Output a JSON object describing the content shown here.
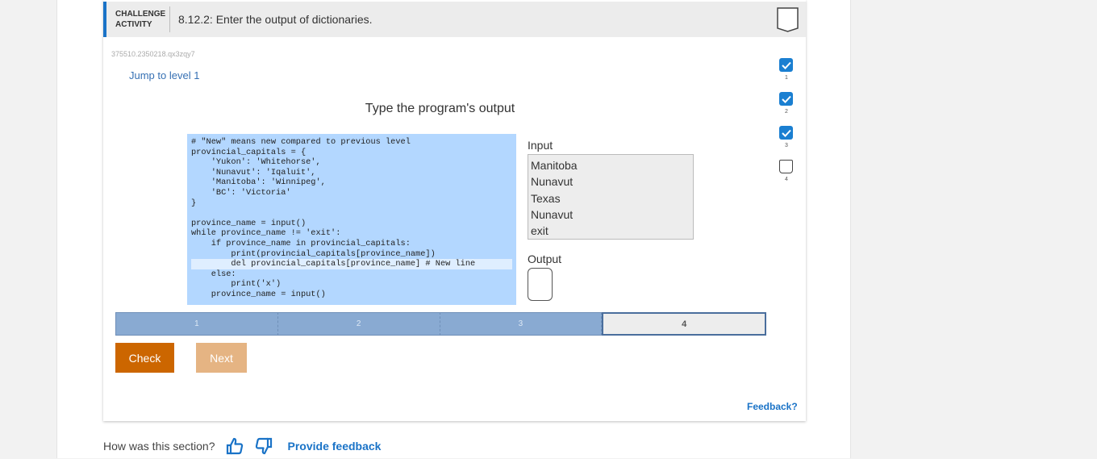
{
  "header": {
    "type_line1": "CHALLENGE",
    "type_line2": "ACTIVITY",
    "title": "8.12.2: Enter the output of dictionaries."
  },
  "activity_id": "375510.2350218.qx3zqy7",
  "jump_label": "Jump to level 1",
  "instruction": "Type the program's output",
  "code_lines": [
    "# \"New\" means new compared to previous level",
    "provincial_capitals = {",
    "    'Yukon': 'Whitehorse',",
    "    'Nunavut': 'Iqaluit',",
    "    'Manitoba': 'Winnipeg',",
    "    'BC': 'Victoria'",
    "}",
    "",
    "province_name = input()",
    "while province_name != 'exit':",
    "    if province_name in provincial_capitals:",
    "        print(provincial_capitals[province_name])",
    "        del provincial_capitals[province_name] # New line",
    "    else:",
    "        print('x')",
    "    province_name = input()"
  ],
  "input": {
    "label": "Input",
    "lines": [
      "Manitoba",
      "Nunavut",
      "Texas",
      "Nunavut",
      "exit"
    ]
  },
  "output": {
    "label": "Output",
    "value": ""
  },
  "levels": [
    {
      "label": "1",
      "status": "done"
    },
    {
      "label": "2",
      "status": "done"
    },
    {
      "label": "3",
      "status": "done"
    },
    {
      "label": "4",
      "status": "current"
    }
  ],
  "buttons": {
    "check": "Check",
    "next": "Next"
  },
  "feedback_link": "Feedback?",
  "progress": [
    {
      "num": "1",
      "done": true
    },
    {
      "num": "2",
      "done": true
    },
    {
      "num": "3",
      "done": true
    },
    {
      "num": "4",
      "done": false
    }
  ],
  "rating": {
    "question": "How was this section?",
    "provide_feedback": "Provide feedback"
  },
  "colors": {
    "accent": "#1a73c7",
    "check_button": "#cc6600",
    "next_button": "#e5b483",
    "code_bg": "#b3d7ff"
  },
  "icons": {
    "badge": "completion-badge-icon",
    "thumbs_up": "thumbs-up-icon",
    "thumbs_down": "thumbs-down-icon",
    "check": "checkmark-icon"
  }
}
